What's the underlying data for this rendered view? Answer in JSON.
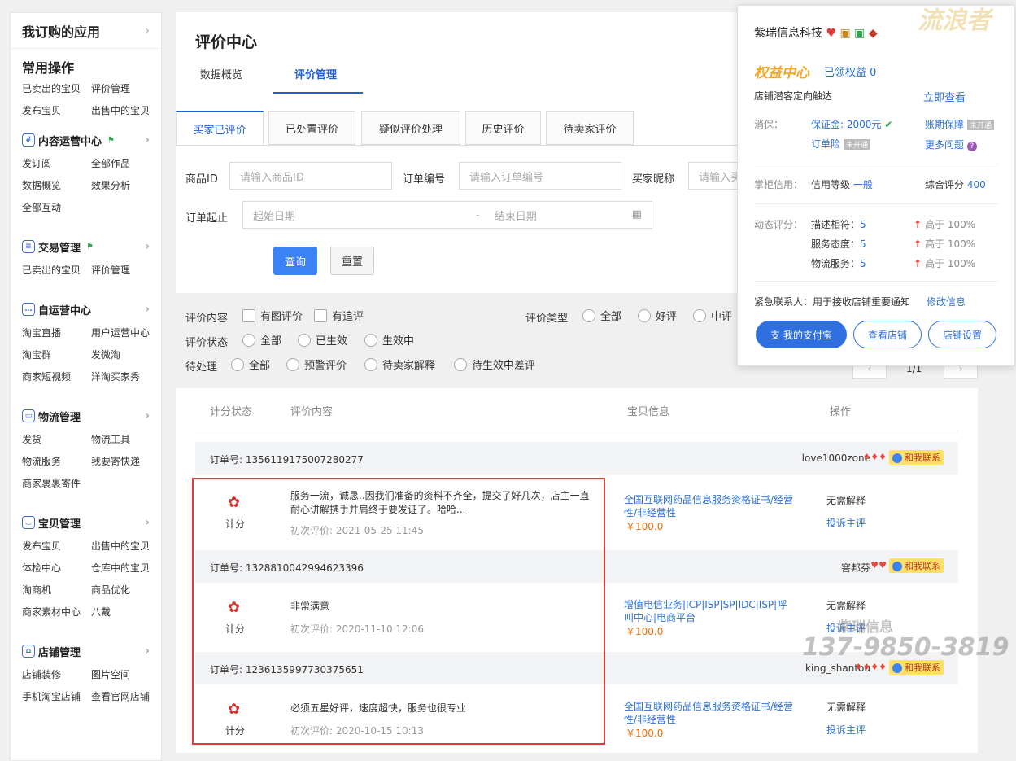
{
  "sidebar": {
    "top_title": "我订购的应用",
    "common": {
      "title": "常用操作",
      "items": [
        "已卖出的宝贝",
        "评价管理",
        "发布宝贝",
        "出售中的宝贝"
      ]
    },
    "sections": [
      {
        "title": "内容运营中心",
        "icon": "hash-icon",
        "items": [
          "发订阅",
          "全部作品",
          "数据概览",
          "效果分析",
          "全部互动"
        ]
      },
      {
        "title": "交易管理",
        "icon": "clipboard-icon",
        "items": [
          "已卖出的宝贝",
          "评价管理"
        ]
      },
      {
        "title": "自运营中心",
        "icon": "chat-icon",
        "items": [
          "淘宝直播",
          "用户运营中心",
          "淘宝群",
          "发微淘",
          "商家短视频",
          "洋淘买家秀"
        ]
      },
      {
        "title": "物流管理",
        "icon": "truck-icon",
        "items": [
          "发货",
          "物流工具",
          "物流服务",
          "我要寄快递",
          "商家裹裹寄件"
        ]
      },
      {
        "title": "宝贝管理",
        "icon": "bag-icon",
        "items": [
          "发布宝贝",
          "出售中的宝贝",
          "体检中心",
          "仓库中的宝贝",
          "淘商机",
          "商品优化",
          "商家素材中心",
          "八戴"
        ]
      },
      {
        "title": "店铺管理",
        "icon": "store-icon",
        "items": [
          "店铺装修",
          "图片空间",
          "手机淘宝店铺",
          "查看官网店铺"
        ]
      }
    ]
  },
  "header": {
    "title": "评价中心",
    "tabs": [
      "数据概览",
      "评价管理"
    ]
  },
  "subtabs": [
    "买家已评价",
    "已处置评价",
    "疑似评价处理",
    "历史评价",
    "待卖家评价"
  ],
  "filters": {
    "product_id_label": "商品ID",
    "product_id_placeholder": "请输入商品ID",
    "order_no_label": "订单编号",
    "order_no_placeholder": "请输入订单编号",
    "buyer_label": "买家昵称",
    "buyer_placeholder": "请输入买",
    "date_label": "订单起止",
    "start_placeholder": "起始日期",
    "date_sep": "-",
    "end_placeholder": "结束日期",
    "search": "查询",
    "reset": "重置"
  },
  "options": {
    "content_label": "评价内容",
    "has_image": "有图评价",
    "has_followup": "有追评",
    "type_label": "评价类型",
    "type_all": "全部",
    "type_good": "好评",
    "type_mid": "中评",
    "status_label": "评价状态",
    "status_all": "全部",
    "status_effective": "已生效",
    "status_pending": "生效中",
    "todo_label": "待处理",
    "todo_all": "全部",
    "todo_warn": "预警评价",
    "todo_explain": "待卖家解释",
    "todo_bad": "待生效中差评"
  },
  "pagination": {
    "page": "1/1"
  },
  "table": {
    "headers": [
      "计分状态",
      "评价内容",
      "宝贝信息",
      "操作"
    ],
    "order_prefix": "订单号: ",
    "contact": "和我联系",
    "rows": [
      {
        "order_no": "1356119175007280277",
        "buyer": "love1000zone",
        "credit": "♦♦♦",
        "score": "计分",
        "content": "服务一流，诚恳..因我们准备的资料不齐全，提交了好几次，店主一直耐心讲解携手并肩终于要发证了。哈哈...",
        "date": "初次评价: 2021-05-25 11:45",
        "product": "全国互联网药品信息服务资格证书/经营性/非经营性",
        "price": "￥100.0",
        "explain": "无需解释",
        "complain": "投诉主评"
      },
      {
        "order_no": "1328810042994623396",
        "buyer": "窨邦芬",
        "credit": "♥♥",
        "score": "计分",
        "content": "非常满意",
        "date": "初次评价: 2020-11-10 12:06",
        "product": "增值电信业务|ICP|ISP|SP|IDC|ISP|呼叫中心|电商平台",
        "price": "￥100.0",
        "explain": "无需解释",
        "complain": "投诉主评"
      },
      {
        "order_no": "1236135997730375651",
        "buyer": "king_shantou",
        "credit": "♦♦♦♦",
        "score": "计分",
        "content": "必须五星好评，速度超快，服务也很专业",
        "date": "初次评价: 2020-10-15 10:13",
        "product": "全国互联网药品信息服务资格证书/经营性/非经营性",
        "price": "￥100.0",
        "explain": "无需解释",
        "complain": "投诉主评"
      }
    ]
  },
  "popup": {
    "shop_name": "紫瑞信息科技",
    "rights_title": "权益中心",
    "rights_received": "已领权益 0",
    "reach": "店铺潜客定向触达",
    "view_now": "立即查看",
    "xiaobao_label": "消保：",
    "deposit": "保证金: 2000元",
    "term_guarantee": "账期保障",
    "not_open": "未开通",
    "order_insurance": "订单险",
    "more_questions": "更多问题",
    "credit_label": "掌柜信用：",
    "credit_level": "信用等级",
    "credit_level_value": "一般",
    "overall_label": "综合评分",
    "overall_value": "400",
    "dynamic_label": "动态评分：",
    "dynamic": [
      {
        "name": "描述相符：",
        "score": "5",
        "compare": "高于 100%"
      },
      {
        "name": "服务态度：",
        "score": "5",
        "compare": "高于 100%"
      },
      {
        "name": "物流服务：",
        "score": "5",
        "compare": "高于 100%"
      }
    ],
    "contact_label": "紧急联系人：用于接收店铺重要通知",
    "modify": "修改信息",
    "btn_alipay": "我的支付宝",
    "btn_view_shop": "查看店铺",
    "btn_settings": "店铺设置"
  },
  "watermarks": {
    "top": "流浪者",
    "company": "紫瑞信息",
    "phone": "137-9850-3819"
  }
}
